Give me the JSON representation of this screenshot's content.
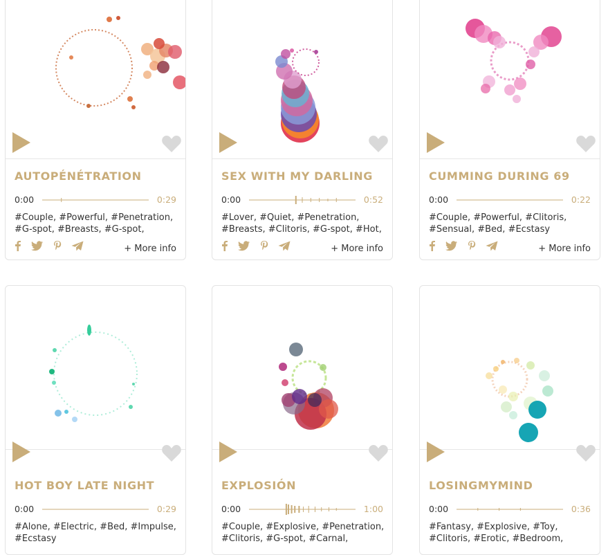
{
  "colors": {
    "gold": "#c9ad7a",
    "heart": "#d9d9d9",
    "text": "#333333",
    "border": "#e3e3e3"
  },
  "more_info_label": "+ More info",
  "share_icons": [
    "facebook-icon",
    "twitter-icon",
    "pinterest-icon",
    "telegram-icon"
  ],
  "cards": [
    {
      "title": "AUTOPÉNÉTRATION",
      "time_current": "0:00",
      "duration": "0:29",
      "progress": 0,
      "tags_line1": "#Couple, #Powerful, #Penetration,",
      "tags_line2": "#G-spot, #Breasts, #G-spot,"
    },
    {
      "title": "SEX WITH MY DARLING",
      "time_current": "0:00",
      "duration": "0:52",
      "progress": 0,
      "tags_line1": "#Lover, #Quiet, #Penetration,",
      "tags_line2": "#Breasts, #Clitoris, #G-spot, #Hot,"
    },
    {
      "title": "CUMMING DURING 69",
      "time_current": "0:00",
      "duration": "0:22",
      "progress": 0,
      "tags_line1": "#Couple, #Powerful, #Clitoris,",
      "tags_line2": "#Sensual, #Bed, #Ecstasy"
    },
    {
      "title": "HOT BOY LATE NIGHT",
      "time_current": "0:00",
      "duration": "0:29",
      "progress": 0,
      "tags_line1": "#Alone, #Electric, #Bed, #Impulse,",
      "tags_line2": "#Ecstasy"
    },
    {
      "title": "EXPLOSIÓN",
      "time_current": "0:00",
      "duration": "1:00",
      "progress": 0,
      "tags_line1": "#Couple, #Explosive, #Penetration,",
      "tags_line2": "#Clitoris, #G-spot, #Carnal,"
    },
    {
      "title": "LOSINGMYMIND",
      "time_current": "0:00",
      "duration": "0:36",
      "progress": 0,
      "tags_line1": "#Fantasy, #Explosive, #Toy,",
      "tags_line2": "#Clitoris, #Erotic, #Bedroom,"
    }
  ]
}
